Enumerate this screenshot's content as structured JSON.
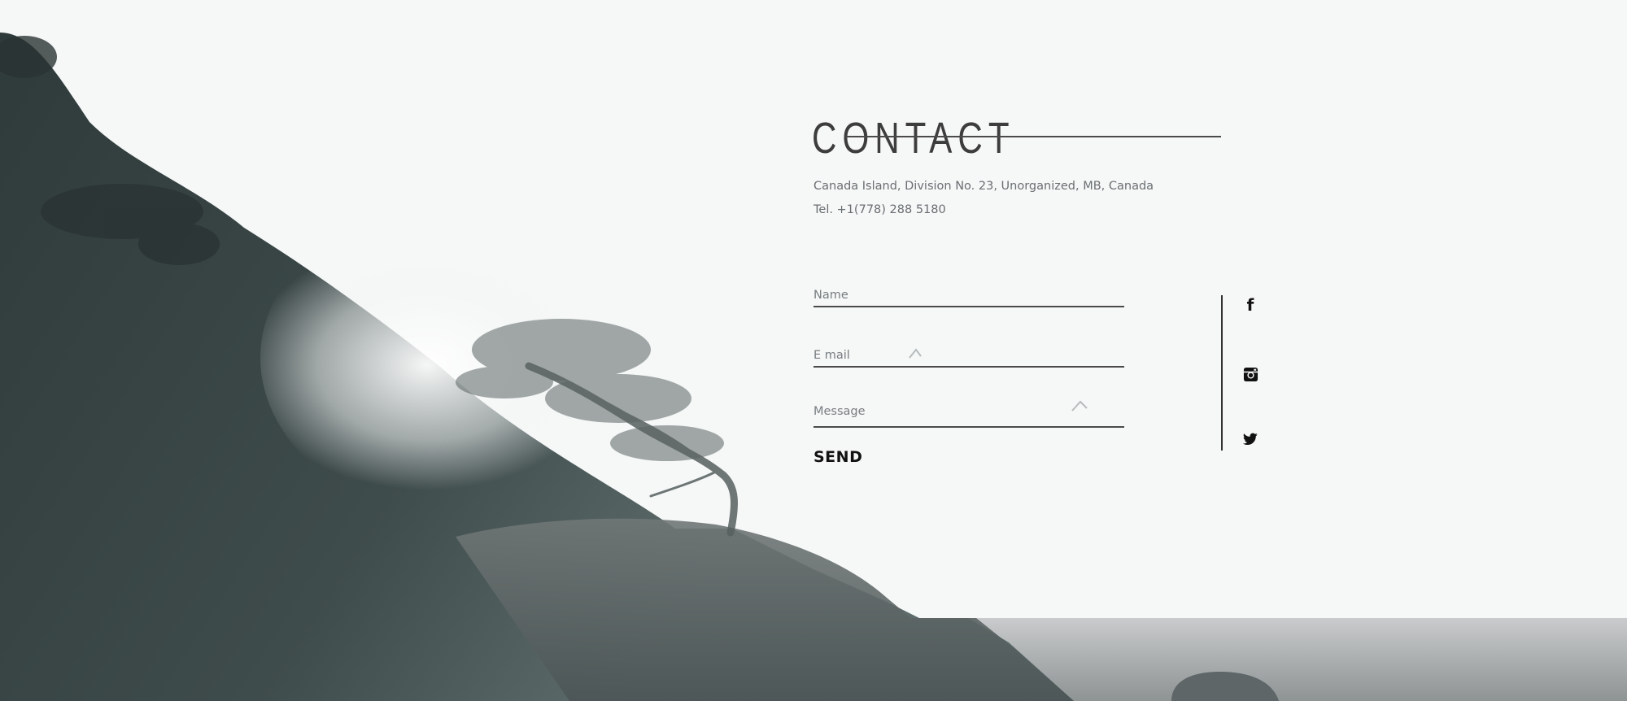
{
  "contact": {
    "title": "CONTACT",
    "address": "Canada Island, Division No. 23, Unorganized, MB, Canada",
    "phone": "Tel. +1(778) 288 5180"
  },
  "form": {
    "name_placeholder": "Name",
    "email_placeholder": "E mail",
    "message_placeholder": "Message",
    "send_label": "SEND"
  },
  "social": {
    "facebook_glyph": "f",
    "items": [
      {
        "icon": "facebook-icon"
      },
      {
        "icon": "instagram-icon"
      },
      {
        "icon": "twitter-icon"
      }
    ]
  },
  "colors": {
    "text_dark": "#3d3d3d",
    "text_muted": "#6a6f72",
    "sky": "#f6f7f7",
    "hill": "#3a4646",
    "sea": "#8a8f91"
  }
}
